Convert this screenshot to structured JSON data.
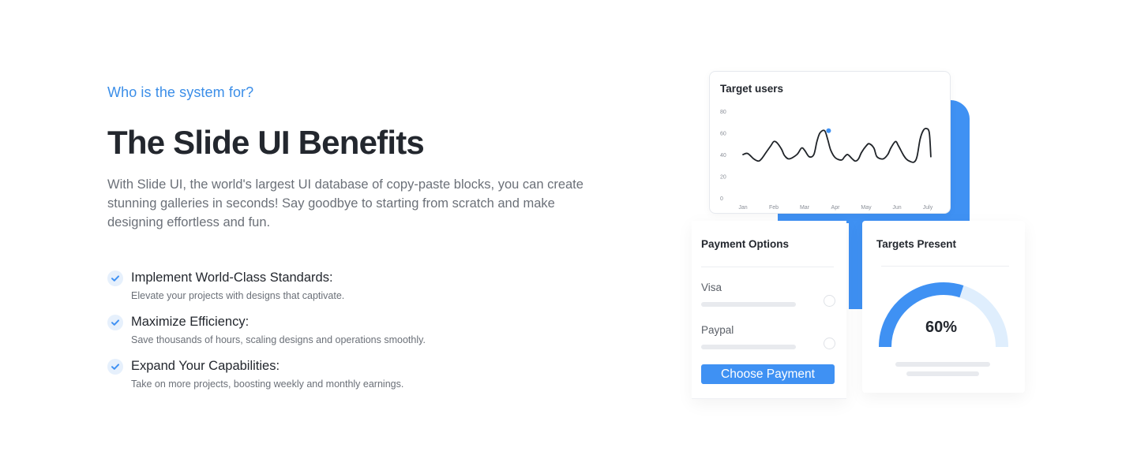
{
  "section": {
    "eyebrow": "Who is the system for?",
    "title": "The Slide UI Benefits",
    "description": "With Slide UI, the world's largest UI database of copy-paste blocks, you can create stunning galleries in seconds! Say goodbye to starting from scratch and make designing effortless and fun."
  },
  "features": [
    {
      "title": "Implement World-Class Standards:",
      "subtitle": "Elevate your projects with designs that captivate.",
      "icon": "check-icon"
    },
    {
      "title": "Maximize Efficiency:",
      "subtitle": "Save thousands of hours, scaling designs and operations smoothly.",
      "icon": "check-icon"
    },
    {
      "title": "Expand Your Capabilities:",
      "subtitle": "Take on more projects, boosting weekly and monthly earnings.",
      "icon": "check-icon"
    }
  ],
  "target_users_card": {
    "title": "Target users",
    "chart_data": {
      "type": "line",
      "title": "Target users",
      "categories": [
        "Jan",
        "Feb",
        "Mar",
        "Apr",
        "May",
        "Jun",
        "July"
      ],
      "y_ticks": [
        0,
        20,
        40,
        60,
        80
      ],
      "ylim": [
        0,
        80
      ],
      "series": [
        {
          "x": [
            0,
            0.15,
            0.35,
            0.5,
            0.6,
            0.75,
            0.9,
            1,
            1.1,
            1.25,
            1.35,
            1.5,
            1.75,
            1.9,
            2,
            2.15,
            2.3,
            2.4,
            2.5,
            2.65,
            2.75,
            2.85,
            3,
            3.2,
            3.3,
            3.4,
            3.55,
            3.65,
            3.75,
            3.85,
            4,
            4.1,
            4.25,
            4.35,
            4.55,
            4.7,
            4.8,
            4.95,
            5.05,
            5.2,
            5.3,
            5.4,
            5.55,
            5.65,
            5.75,
            5.85,
            5.95,
            6.05,
            6.1
          ],
          "values": [
            40,
            41,
            36,
            34,
            36,
            42,
            48,
            52,
            51,
            45,
            39,
            36,
            40,
            46,
            44,
            38,
            40,
            52,
            60,
            62,
            54,
            44,
            37,
            35,
            38,
            40,
            36,
            34,
            36,
            42,
            48,
            50,
            46,
            38,
            36,
            40,
            46,
            52,
            48,
            40,
            36,
            34,
            33,
            38,
            54,
            62,
            64,
            60,
            38
          ]
        }
      ],
      "highlight": {
        "x": 2.78,
        "value": 62,
        "color": "#3f91f3"
      },
      "grid": false
    }
  },
  "payment_card": {
    "title": "Payment Options",
    "options": [
      {
        "label": "Visa"
      },
      {
        "label": "Paypal"
      }
    ],
    "button_label": "Choose Payment"
  },
  "targets_card": {
    "title": "Targets Present",
    "value_label": "60%",
    "percent": 60
  },
  "colors": {
    "accent": "#3f91f3",
    "eyebrow": "#3b8ee8",
    "gauge_track": "#dfeefd",
    "heading": "#23272e",
    "body_text": "#6b7078"
  }
}
